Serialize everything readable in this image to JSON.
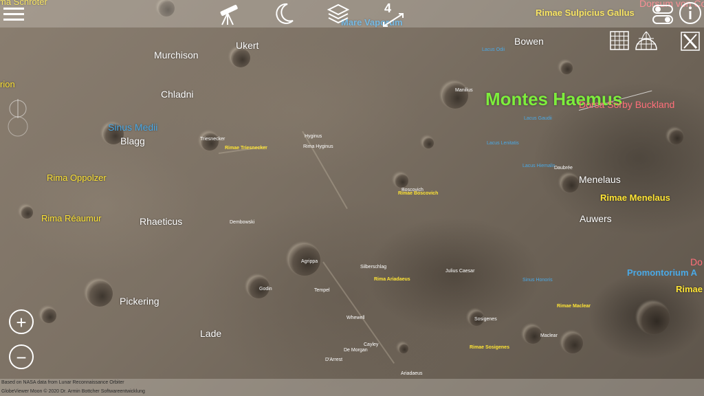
{
  "toolbar": {
    "menu_icon": "hamburger-menu-icon",
    "telescope_icon": "telescope-icon",
    "moon_icon": "crescent-moon-icon",
    "layers_icon": "layers-icon",
    "measure_count": "4",
    "measure_icon": "measure-icon",
    "toggle_icon": "toggle-switch-icon",
    "info_icon": "info-icon"
  },
  "overlay_tools": {
    "grid_icon": "grid-icon",
    "globe_grid_icon": "globe-grid-icon",
    "x_icon": "x-box-icon"
  },
  "zoom": {
    "in": "+",
    "out": "−"
  },
  "labels": {
    "rima_schroter": "ma Schröter",
    "mare_vaporum": "Mare Vaporum",
    "dorsum_von_cotta": "Dorsum von Cotta",
    "rimae_sulpicius_gallus": "Rimae Sulpicius Gallus",
    "ukert": "Ukert",
    "murchison": "Murchison",
    "bowen": "Bowen",
    "lacus_odii": "Lacus Odii",
    "rima_left": "rion",
    "chladni": "Chladni",
    "manilius": "Manilius",
    "montes_haemus": "Montes Haemus",
    "dorsa_sorby_buckland": "Dorsa Sorby Buckland",
    "sinus_medii": "Sinus Medii",
    "lacus_gaudii": "Lacus Gaudii",
    "blagg": "Blagg",
    "triesnecker": "Triesnecker",
    "rimae_triesnecker": "Rimae Triesnecker",
    "hyginus": "Hyginus",
    "rima_hyginus": "Rima Hyginus",
    "lacus_lenitatis": "Lacus Lenitatis",
    "lacus_hiemalis": "Lacus Hiemalis",
    "daubree": "Daubrée",
    "rima_oppolzer": "Rima Oppolzer",
    "menelaus": "Menelaus",
    "boscovich": "Boscovich",
    "rimae_boscovich": "Rimae Boscovich",
    "rimae_menelaus": "Rimae Menelaus",
    "rima_reaumur": "Rima Réaumur",
    "rhaeticus": "Rhaeticus",
    "dembowski": "Dembowski",
    "auwers": "Auwers",
    "agrippa": "Agrippa",
    "silberschlag": "Silberschlag",
    "julius_caesar": "Julius Caesar",
    "do_partial": "Do",
    "promontorium": "Promontorium A",
    "rima_ariadaeus": "Rima Ariadaeus",
    "sinus_honoris": "Sinus Honoris",
    "godin": "Godin",
    "tempel": "Tempel",
    "rimae_partial": "Rimae",
    "pickering": "Pickering",
    "rimae_maclear": "Rimae Maclear",
    "whewell": "Whewell",
    "sosigenes": "Sosigenes",
    "lade": "Lade",
    "maclear": "Maclear",
    "cayley": "Cayley",
    "de_morgan": "De Morgan",
    "rimae_sosigenes": "Rimae Sosigenes",
    "d_arrest": "D'Arrest",
    "arago_partial": "Ariadaeus"
  },
  "footer": {
    "credit1": "Based on NASA data from Lunar Reconnaissance Orbiter",
    "credit2": "GlobeViewer Moon © 2020 Dr. Armin Bottcher Softwareentwicklung"
  },
  "colors": {
    "feature_label": "#ffffff",
    "rima_label": "#ffe535",
    "mare_label": "#4aa9e6",
    "dorsum_label": "#ff6f7a",
    "montes_label": "#7dee3c"
  }
}
